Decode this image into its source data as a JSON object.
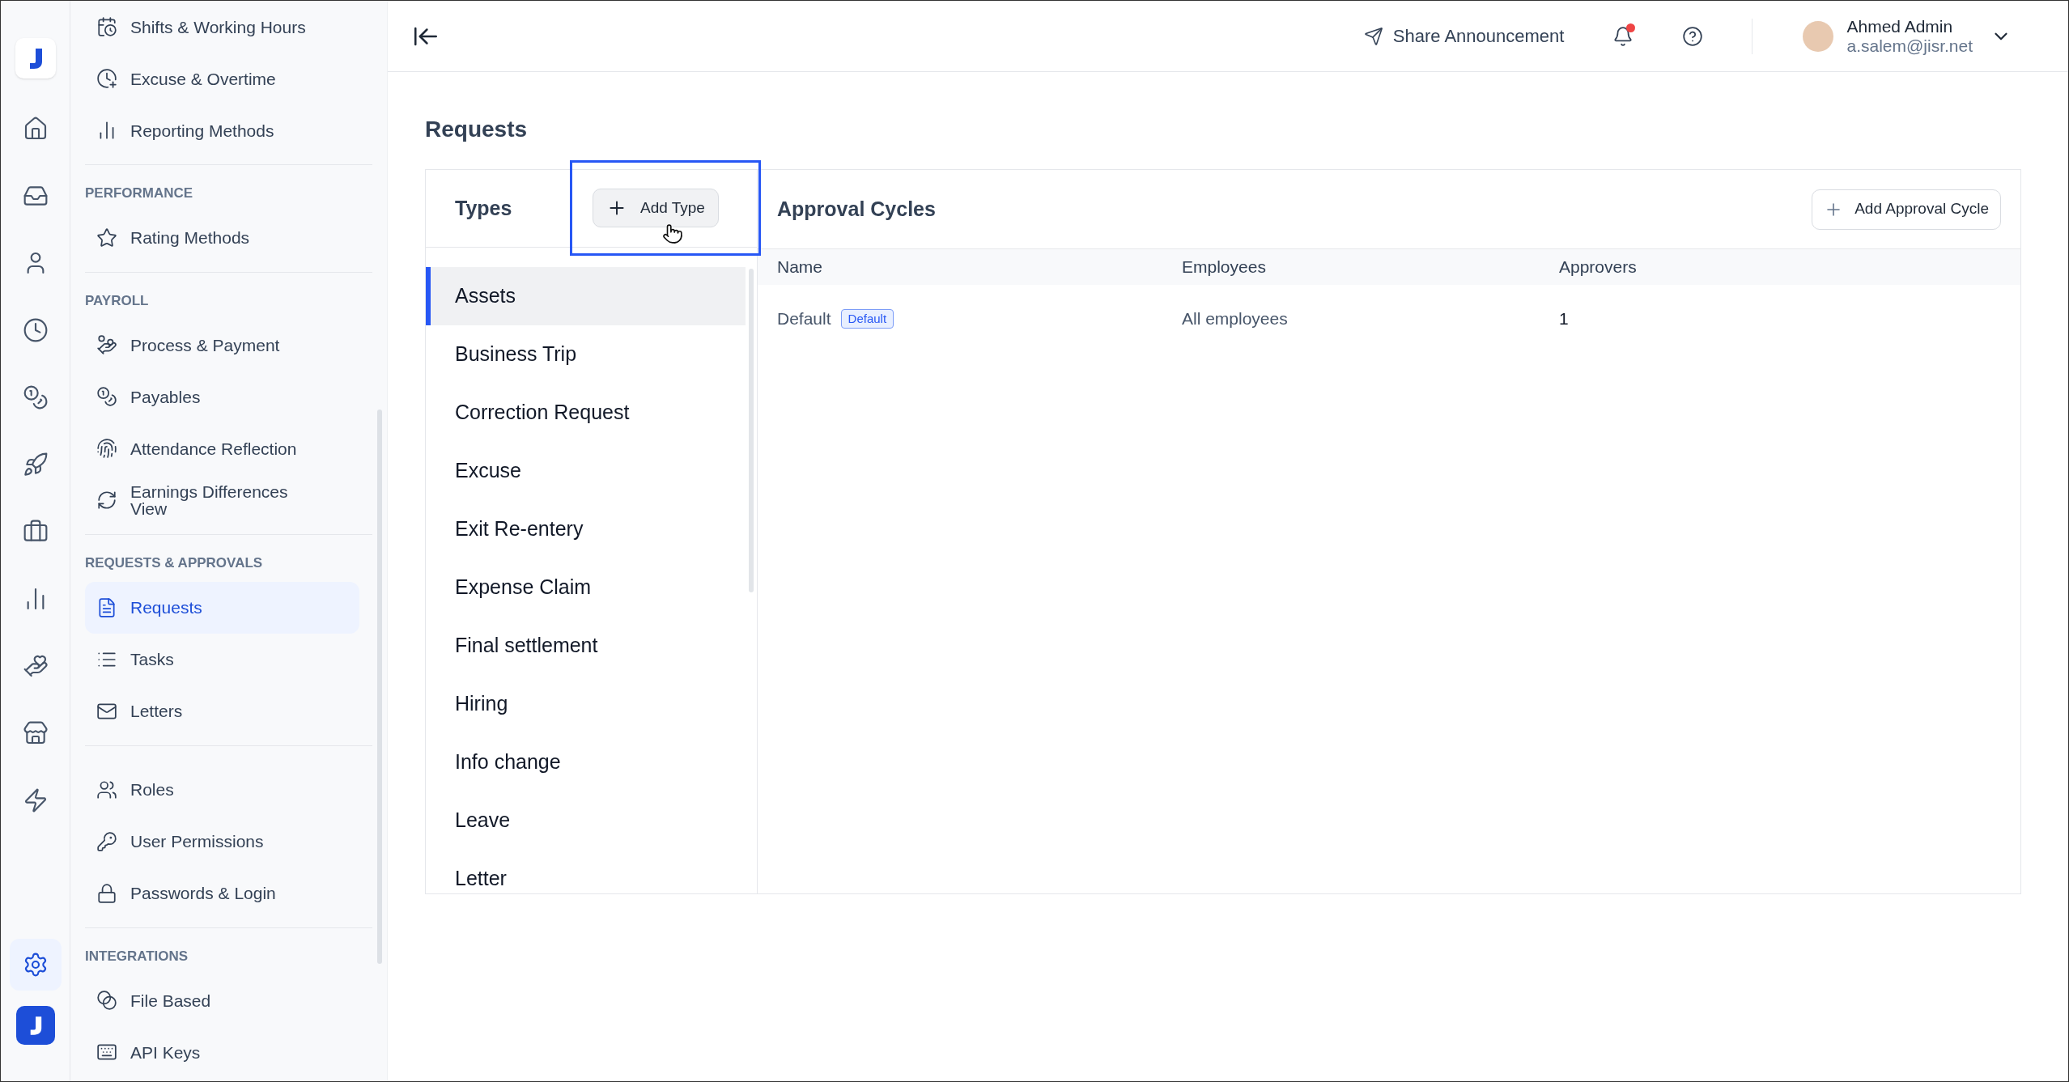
{
  "rail": {
    "items": [
      {
        "kind": "home",
        "selected": false
      },
      {
        "kind": "inbox",
        "selected": false
      },
      {
        "kind": "user",
        "selected": false
      },
      {
        "kind": "clock",
        "selected": false
      },
      {
        "kind": "coins",
        "selected": false
      },
      {
        "kind": "rocket",
        "selected": false
      },
      {
        "kind": "briefcase",
        "selected": false
      },
      {
        "kind": "chart",
        "selected": false
      },
      {
        "kind": "hand",
        "selected": false
      },
      {
        "kind": "store",
        "selected": false
      },
      {
        "kind": "zap",
        "selected": false
      },
      {
        "kind": "settings",
        "selected": true
      }
    ]
  },
  "sidebar": {
    "sections": [
      {
        "items": [
          {
            "label": "Shifts & Working Hours",
            "kind": "shifts",
            "selected": false
          },
          {
            "label": "Excuse & Overtime",
            "kind": "clockplus",
            "selected": false
          },
          {
            "label": "Reporting Methods",
            "kind": "chart",
            "selected": false
          }
        ]
      },
      {
        "heading": "PERFORMANCE",
        "items": [
          {
            "label": "Rating Methods",
            "kind": "star",
            "selected": false
          }
        ]
      },
      {
        "heading": "PAYROLL",
        "items": [
          {
            "label": "Process & Payment",
            "kind": "handcoins",
            "selected": false
          },
          {
            "label": "Payables",
            "kind": "coins",
            "selected": false
          },
          {
            "label": "Attendance Reflection",
            "kind": "fingerprint",
            "selected": false
          },
          {
            "label": "Earnings Differences View",
            "kind": "refresh",
            "selected": false
          }
        ]
      },
      {
        "heading": "REQUESTS & APPROVALS",
        "items": [
          {
            "label": "Requests",
            "kind": "file",
            "selected": true
          },
          {
            "label": "Tasks",
            "kind": "list",
            "selected": false
          },
          {
            "label": "Letters",
            "kind": "mail",
            "selected": false
          }
        ]
      },
      {
        "items": [
          {
            "label": "Roles",
            "kind": "users",
            "selected": false
          },
          {
            "label": "User Permissions",
            "kind": "key",
            "selected": false
          },
          {
            "label": "Passwords & Login",
            "kind": "lock",
            "selected": false
          }
        ]
      },
      {
        "heading": "INTEGRATIONS",
        "items": [
          {
            "label": "File Based",
            "kind": "blend",
            "selected": false
          },
          {
            "label": "API Keys",
            "kind": "apikey",
            "selected": false
          }
        ]
      }
    ]
  },
  "header": {
    "share": "Share Announcement",
    "notification_unread": true,
    "user": {
      "name": "Ahmed Admin",
      "email": "a.salem@jisr.net"
    }
  },
  "page": {
    "title": "Requests"
  },
  "types": {
    "title": "Types",
    "add_button": "Add Type",
    "items": [
      {
        "label": "Assets",
        "selected": true
      },
      {
        "label": "Business Trip",
        "selected": false
      },
      {
        "label": "Correction Request",
        "selected": false
      },
      {
        "label": "Excuse",
        "selected": false
      },
      {
        "label": "Exit Re-entery",
        "selected": false
      },
      {
        "label": "Expense Claim",
        "selected": false
      },
      {
        "label": "Final settlement",
        "selected": false
      },
      {
        "label": "Hiring",
        "selected": false
      },
      {
        "label": "Info change",
        "selected": false
      },
      {
        "label": "Leave",
        "selected": false
      },
      {
        "label": "Letter",
        "selected": false
      }
    ]
  },
  "approval_cycles": {
    "title": "Approval Cycles",
    "add_button": "Add Approval Cycle",
    "table": {
      "columns": [
        "Name",
        "Employees",
        "Approvers"
      ],
      "rows": [
        {
          "name": "Default",
          "badge": "Default",
          "employees": "All employees",
          "approvers": "1"
        }
      ]
    }
  }
}
